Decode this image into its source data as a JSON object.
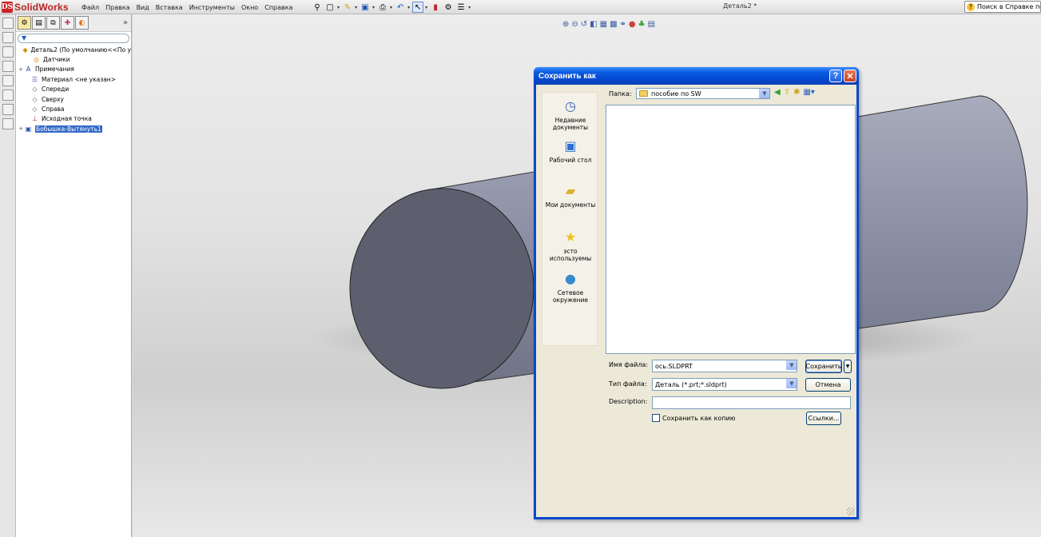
{
  "app": {
    "brand": "SolidWorks",
    "menu": [
      "Файл",
      "Правка",
      "Вид",
      "Вставка",
      "Инструменты",
      "Окно",
      "Справка"
    ],
    "document_title": "Деталь2 *",
    "help_search": "Поиск в Справке по"
  },
  "feature_manager": {
    "tree": [
      {
        "label": "Деталь2  (По умолчанию<<По у",
        "icon": "part-icon",
        "expander": ""
      },
      {
        "label": "Датчики",
        "icon": "sensor-icon",
        "expander": ""
      },
      {
        "label": "Примечания",
        "icon": "annotations-icon",
        "expander": "+"
      },
      {
        "label": "Материал <не указан>",
        "icon": "material-icon",
        "expander": ""
      },
      {
        "label": "Спереди",
        "icon": "plane-icon",
        "expander": ""
      },
      {
        "label": "Сверху",
        "icon": "plane-icon",
        "expander": ""
      },
      {
        "label": "Справа",
        "icon": "plane-icon",
        "expander": ""
      },
      {
        "label": "Исходная точка",
        "icon": "origin-icon",
        "expander": ""
      },
      {
        "label": "Бобышка-Вытянуть1",
        "icon": "extrude-icon",
        "expander": "+",
        "selected": true
      }
    ]
  },
  "dialog": {
    "title": "Сохранить как",
    "help_glyph": "?",
    "close_glyph": "✕",
    "places": [
      {
        "label": "Недавние документы",
        "icon": "recent-documents-icon"
      },
      {
        "label": "Рабочий стол",
        "icon": "desktop-icon"
      },
      {
        "label": "Мои документы",
        "icon": "my-documents-icon"
      },
      {
        "label": "эсто используемы",
        "icon": "favorites-star-icon"
      },
      {
        "label": "Сетевое окружение",
        "icon": "network-icon"
      }
    ],
    "lookin_label": "Папка:",
    "lookin_value": "пособие по SW",
    "filename_label": "Имя файла:",
    "filename_value": "ось.SLDPRT",
    "filetype_label": "Тип файла:",
    "filetype_value": "Деталь (*.prt;*.sldprt)",
    "description_label": "Description:",
    "description_value": "",
    "save_copy_label": "Сохранить как копию",
    "save_button": "Сохранить",
    "cancel_button": "Отмена",
    "references_button": "Ссылки..."
  },
  "colors": {
    "titlebar": "#0549d0",
    "selection": "#3169c6",
    "cylinder_face": "#5d5f6e",
    "cylinder_body": "#8a8ea2"
  }
}
